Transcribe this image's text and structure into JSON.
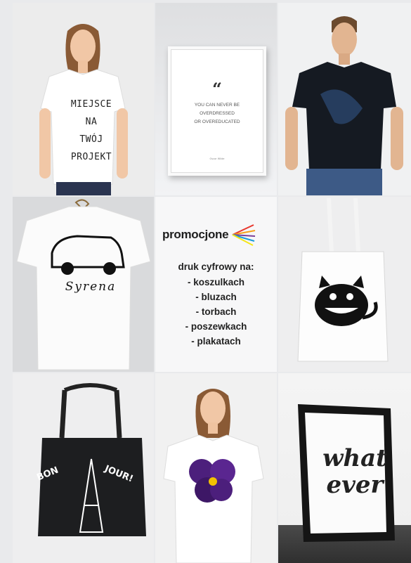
{
  "tiles": {
    "tshirt_text": [
      "MIEJSCE",
      "NA",
      "TWÓJ",
      "PROJEKT"
    ],
    "poster_quote": {
      "mark": "“",
      "lines": [
        "YOU CAN NEVER BE",
        "OVERDRESSED",
        "OR OVEREDUCATED"
      ],
      "author": "Oscar Wilde"
    },
    "syrena_label": "Syrena",
    "bag_text": [
      "BON",
      "JOUR!"
    ],
    "whatever": [
      "what",
      "ever"
    ]
  },
  "promo": {
    "brand": "promocjone",
    "brand_small": "...",
    "offer_title": "druk cyfrowy na:",
    "offer_items": [
      "- koszulkach",
      "- bluzach",
      "- torbach",
      "- poszewkach",
      "- plakatach"
    ]
  },
  "colors": {
    "brand_lines": [
      "#e8362c",
      "#f6a11a",
      "#7b3f98",
      "#1b9cd8",
      "#f4e61a"
    ]
  }
}
